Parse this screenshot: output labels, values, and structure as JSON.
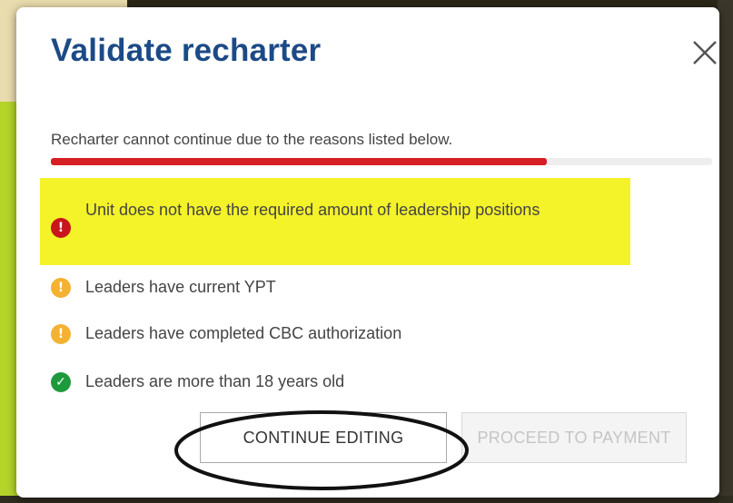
{
  "dialog": {
    "title": "Validate recharter",
    "close_icon": "close-icon",
    "subtitle": "Recharter cannot continue due to the reasons listed below.",
    "progress_fraction": 0.75,
    "items": [
      {
        "text": "Unit does not have the required amount of leadership positions",
        "status": "error",
        "icon": "error-icon",
        "glyph": "!",
        "color": "#c8161d",
        "highlighted": true
      },
      {
        "text": "Leaders have current YPT",
        "status": "warning",
        "icon": "warning-icon",
        "glyph": "!",
        "color": "#f4b233"
      },
      {
        "text": "Leaders have completed CBC authorization",
        "status": "warning",
        "icon": "warning-icon",
        "glyph": "!",
        "color": "#f4b233"
      },
      {
        "text": "Leaders are more than 18 years old",
        "status": "success",
        "icon": "check-icon",
        "glyph": "✓",
        "color": "#1e9a3d"
      }
    ],
    "buttons": {
      "continue_label": "CONTINUE EDITING",
      "proceed_label": "PROCEED TO PAYMENT",
      "proceed_disabled": true
    }
  },
  "colors": {
    "title": "#1c4a86",
    "progress": "#d51f23",
    "highlight": "#f4f229"
  }
}
